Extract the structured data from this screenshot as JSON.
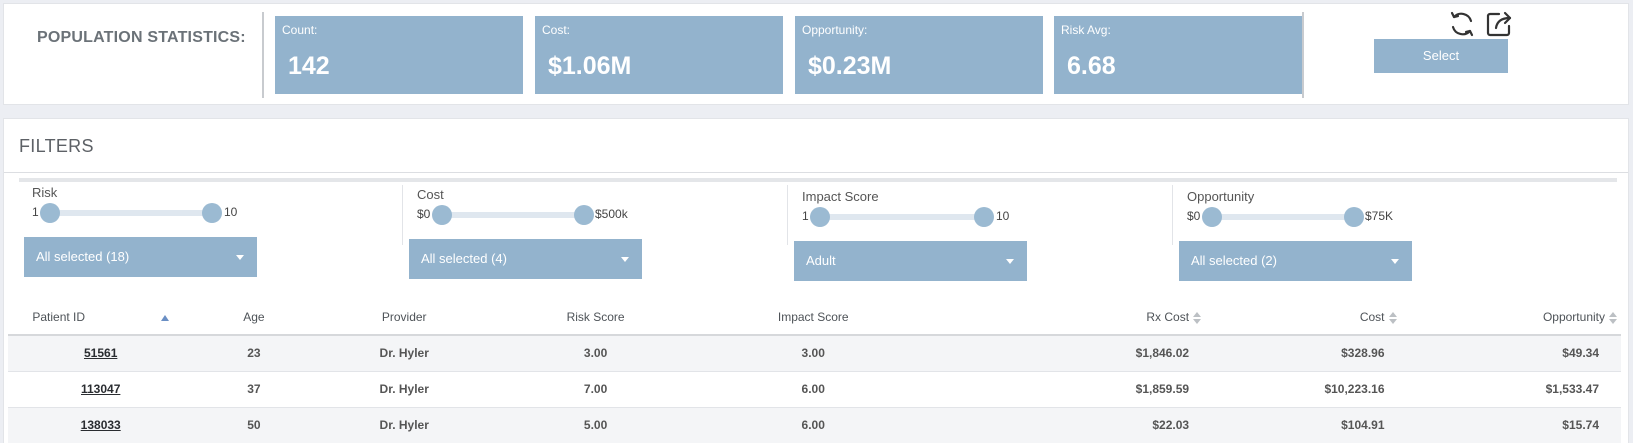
{
  "stats": {
    "title": "POPULATION STATISTICS:",
    "cards": [
      {
        "label": "Count:",
        "value": "142"
      },
      {
        "label": "Cost:",
        "value": "$1.06M"
      },
      {
        "label": "Opportunity:",
        "value": "$0.23M"
      },
      {
        "label": "Risk Avg:",
        "value": "6.68"
      }
    ],
    "select_label": "Select",
    "icons": {
      "refresh": "refresh-icon",
      "share": "share-icon"
    }
  },
  "filters": {
    "title": "FILTERS",
    "groups": [
      {
        "label": "Risk",
        "min": "1",
        "max": "10",
        "dropdown": "All selected (18)"
      },
      {
        "label": "Cost",
        "min": "$0",
        "max": "$500k",
        "dropdown": "All selected (4)"
      },
      {
        "label": "Impact Score",
        "min": "1",
        "max": "10",
        "dropdown": "Adult"
      },
      {
        "label": "Opportunity",
        "min": "$0",
        "max": "$75K",
        "dropdown": "All selected (2)"
      }
    ]
  },
  "table": {
    "headers": [
      "Patient ID",
      "Age",
      "Provider",
      "Risk Score",
      "Impact Score",
      "Rx Cost",
      "Cost",
      "Opportunity"
    ],
    "rows": [
      [
        "51561",
        "23",
        "Dr. Hyler",
        "3.00",
        "3.00",
        "$1,846.02",
        "$328.96",
        "$49.34"
      ],
      [
        "113047",
        "37",
        "Dr. Hyler",
        "7.00",
        "6.00",
        "$1,859.59",
        "$10,223.16",
        "$1,533.47"
      ],
      [
        "138033",
        "50",
        "Dr. Hyler",
        "5.00",
        "6.00",
        "$22.03",
        "$104.91",
        "$15.74"
      ]
    ]
  },
  "colors": {
    "card_bg": "#93b3cd",
    "knob": "#9bbad2",
    "sort_active": "#6a8fc4"
  }
}
